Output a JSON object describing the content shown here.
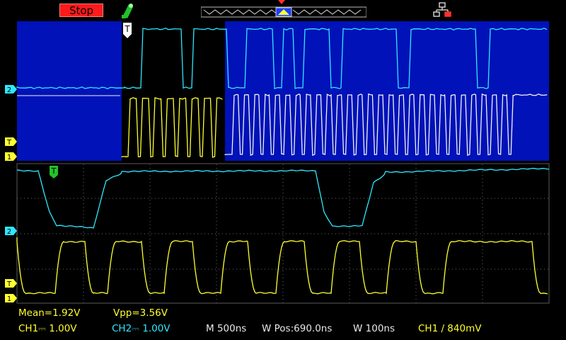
{
  "toolbar": {
    "run_state": "Stop",
    "trigger_icon": "trigger-status-icon",
    "network_icon": "network-disconnected-icon",
    "timebase_marker": "T"
  },
  "markers": {
    "main_ch2": "2",
    "main_trig": "T",
    "main_ch1": "1",
    "zoom_ch2": "2",
    "zoom_trig": "T",
    "zoom_ch1": "1",
    "top_trig": "T",
    "zoom_top_trig": "T"
  },
  "measurements": {
    "mean": "Mean=1.92V",
    "vpp": "Vpp=3.56V"
  },
  "status": {
    "ch1": "CH1⎓ 1.00V",
    "ch2": "CH2⎓ 1.00V",
    "timebase": "M 500ns",
    "wpos": "W Pos:690.0ns",
    "window": "W 100ns",
    "trigger": "CH1 ∕ 840mV"
  },
  "colors": {
    "ch1": "#ffff30",
    "ch2": "#2ee8ff",
    "main_bg": "#0012b8",
    "window_bg": "#000000",
    "stop_button": "#ff1a1a"
  }
}
